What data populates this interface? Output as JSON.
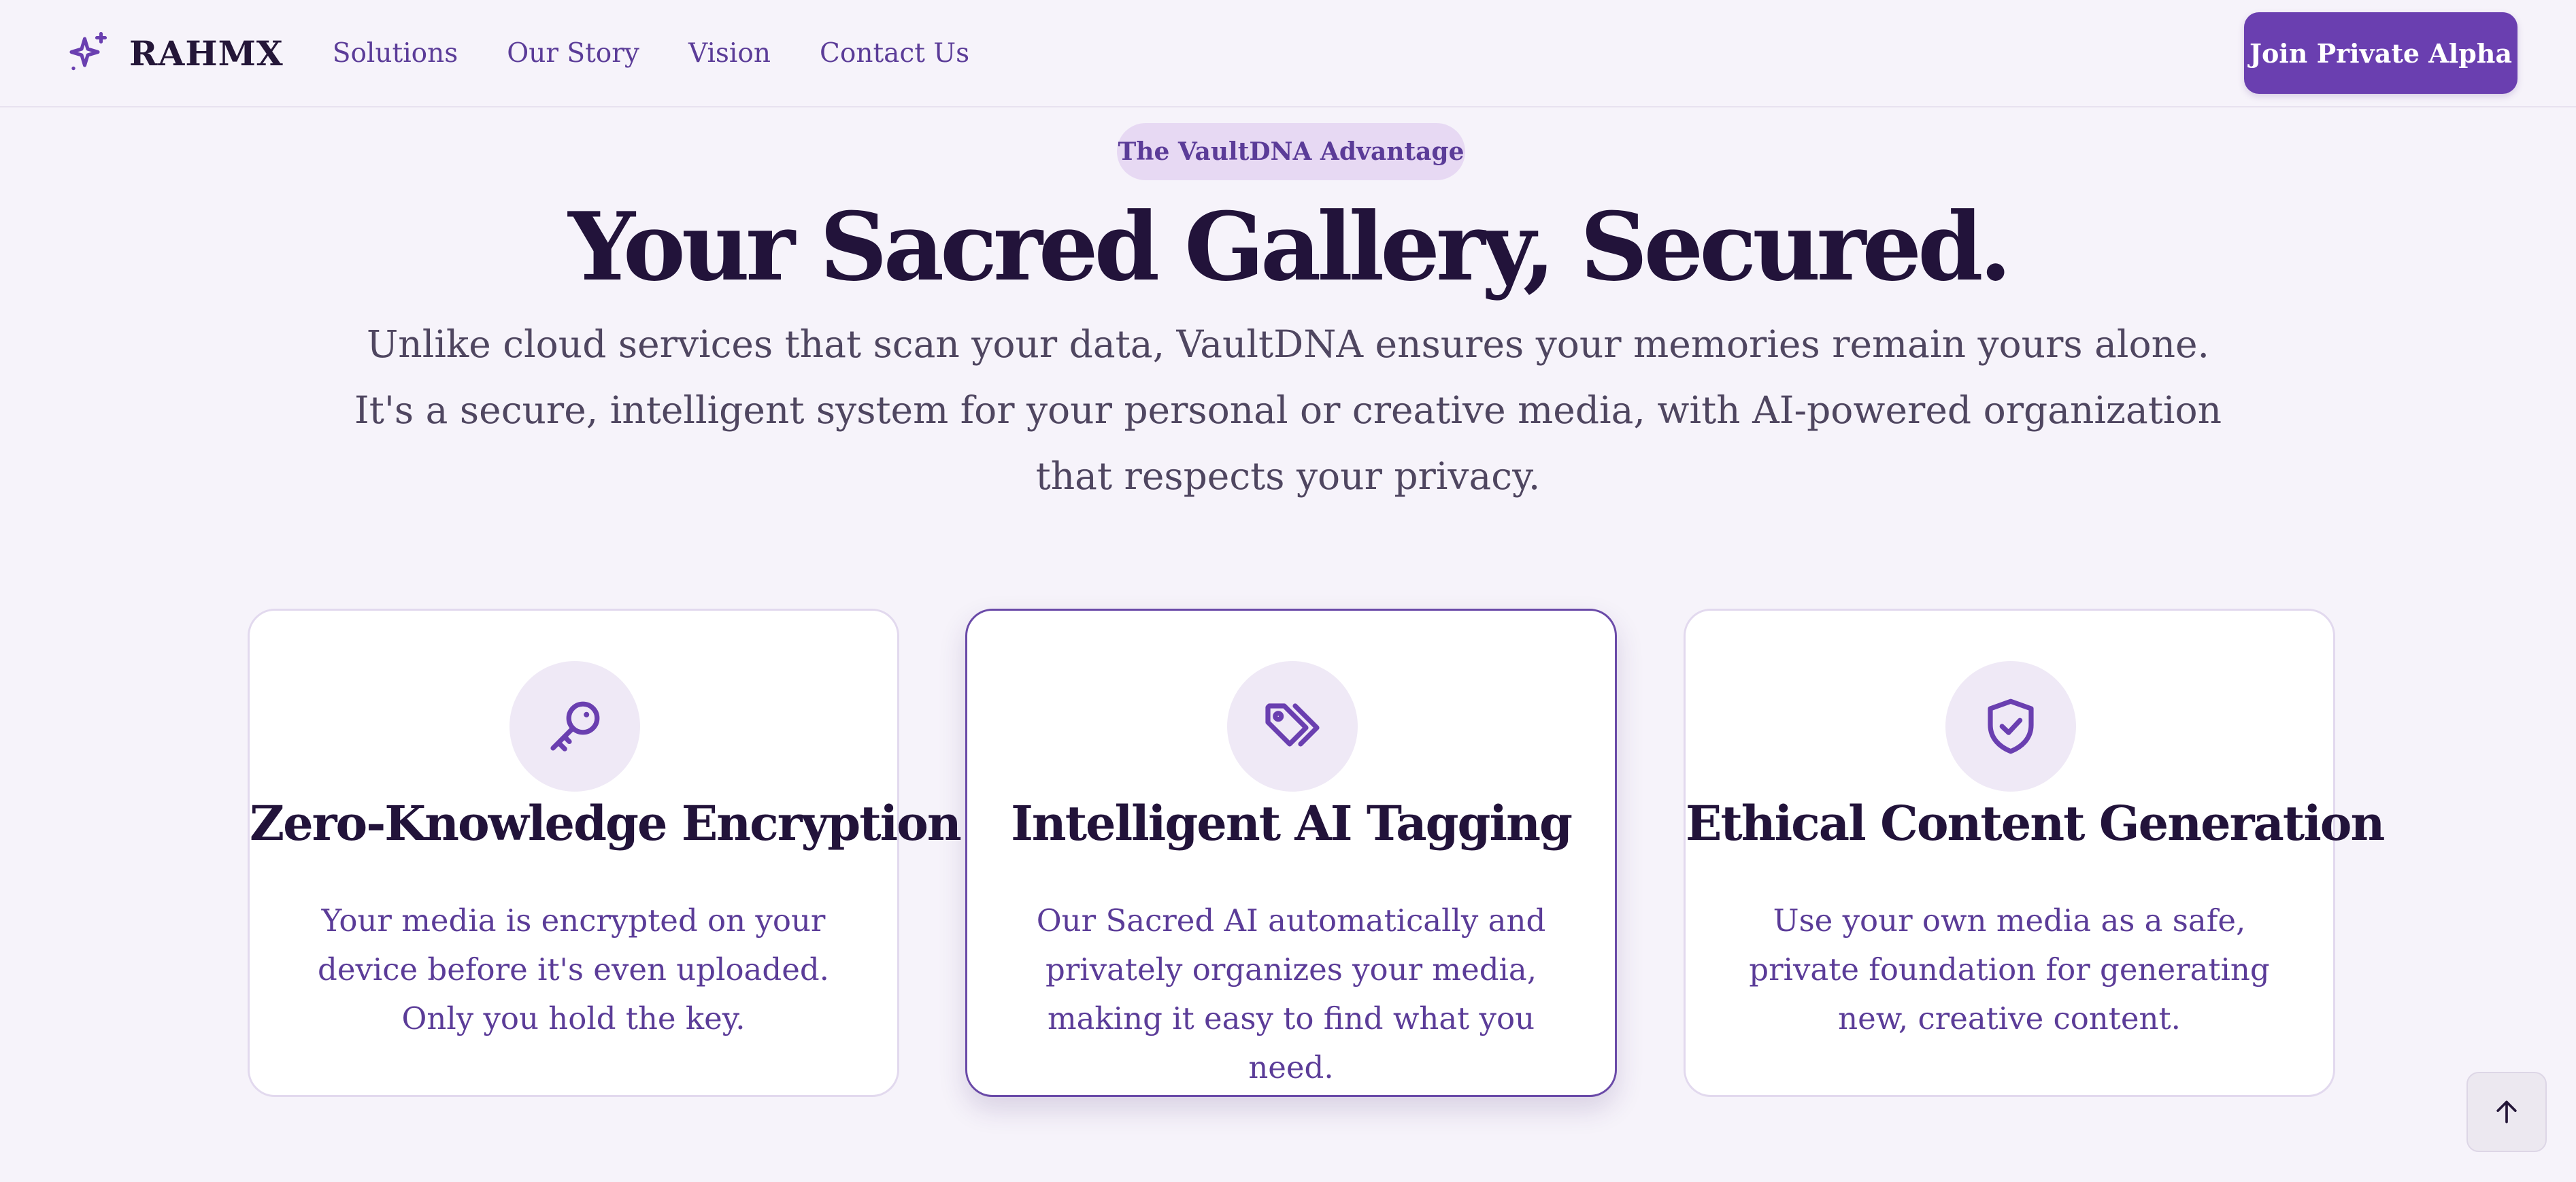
{
  "brand": {
    "name": "RAHMX",
    "icon": "sparkles-icon"
  },
  "nav": {
    "links": [
      "Solutions",
      "Our Story",
      "Vision",
      "Contact Us"
    ],
    "cta_label": "Join Private Alpha"
  },
  "hero": {
    "badge": "The VaultDNA Advantage",
    "title": "Your Sacred Gallery, Secured.",
    "subtitle": "Unlike cloud services that scan your data, VaultDNA ensures your memories remain yours alone. It's a secure, intelligent system for your personal or creative media, with AI-powered organization that respects your privacy."
  },
  "features": [
    {
      "icon": "key-icon",
      "title": "Zero-Knowledge Encryption",
      "text": "Your media is encrypted on your device before it's even uploaded. Only you hold the key."
    },
    {
      "icon": "tags-icon",
      "title": "Intelligent AI Tagging",
      "text": "Our Sacred AI automatically and privately organizes your media, making it easy to find what you need."
    },
    {
      "icon": "shield-check-icon",
      "title": "Ethical Content Generation",
      "text": "Use your own media as a safe, private foundation for generating new, creative content."
    }
  ],
  "scroll_top": {
    "icon": "arrow-up-icon"
  },
  "colors": {
    "accent": "#6a3fb0",
    "badge_bg": "#e7d9f3",
    "heading": "#22133a",
    "link": "#5b3c98",
    "background": "#f6f3fa"
  }
}
